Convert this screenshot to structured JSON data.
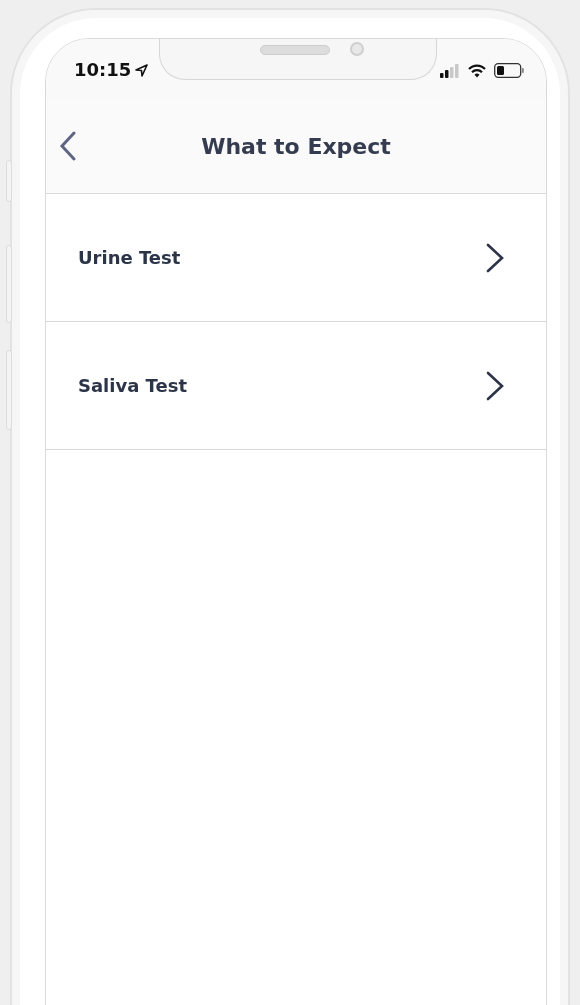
{
  "status_bar": {
    "time": "10:15"
  },
  "header": {
    "title": "What to Expect"
  },
  "items": [
    {
      "label": "Urine Test"
    },
    {
      "label": "Saliva Test"
    }
  ]
}
